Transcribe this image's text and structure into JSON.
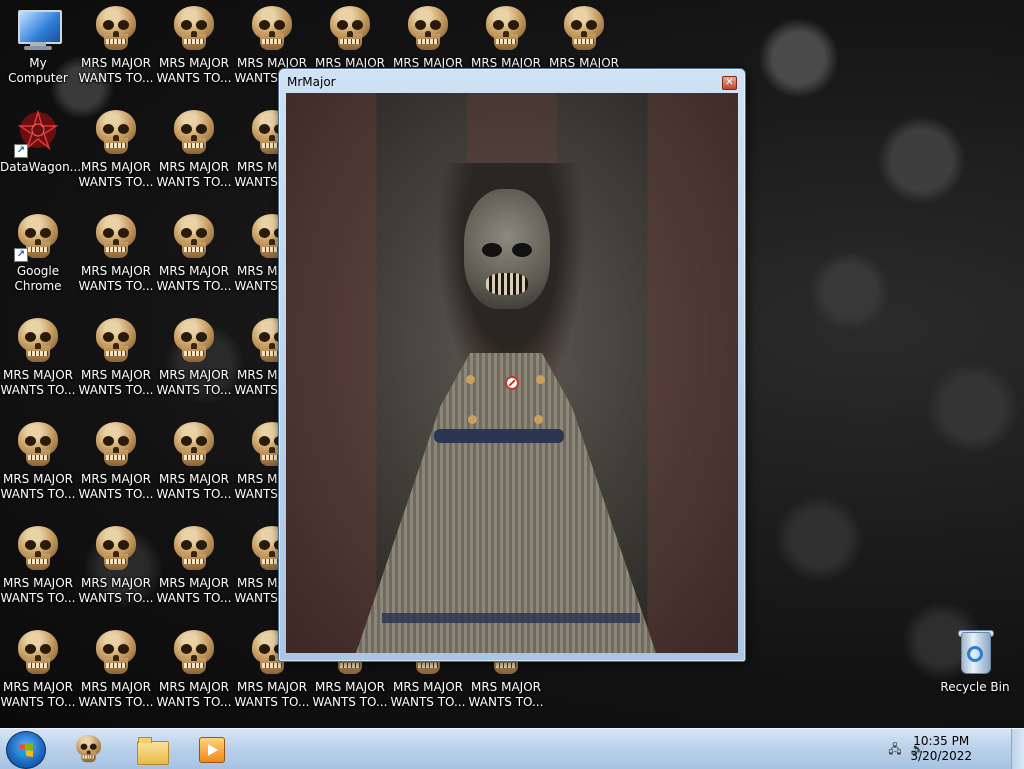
{
  "desktop": {
    "icons": {
      "my_computer": "My Computer",
      "datawagon": "DataWagon...",
      "google_chrome": "Google\nChrome",
      "mrs_major": "MRS MAJOR\nWANTS TO...",
      "recycle_bin": "Recycle Bin"
    }
  },
  "window": {
    "title": "MrMajor",
    "close_glyph": "✕"
  },
  "taskbar": {
    "start_label": "Start",
    "pinned": [
      "MrMajor",
      "Windows Explorer",
      "Windows Media Player"
    ],
    "tray": {
      "time": "10:35 PM",
      "date": "3/20/2022",
      "network_icon": "network-icon",
      "volume_icon": "volume-icon"
    }
  },
  "colors": {
    "taskbar_top": "#d7e6f5",
    "taskbar_bottom": "#a7c3e2",
    "window_frame": "#a9c6e4",
    "close_button": "#c2452d"
  }
}
